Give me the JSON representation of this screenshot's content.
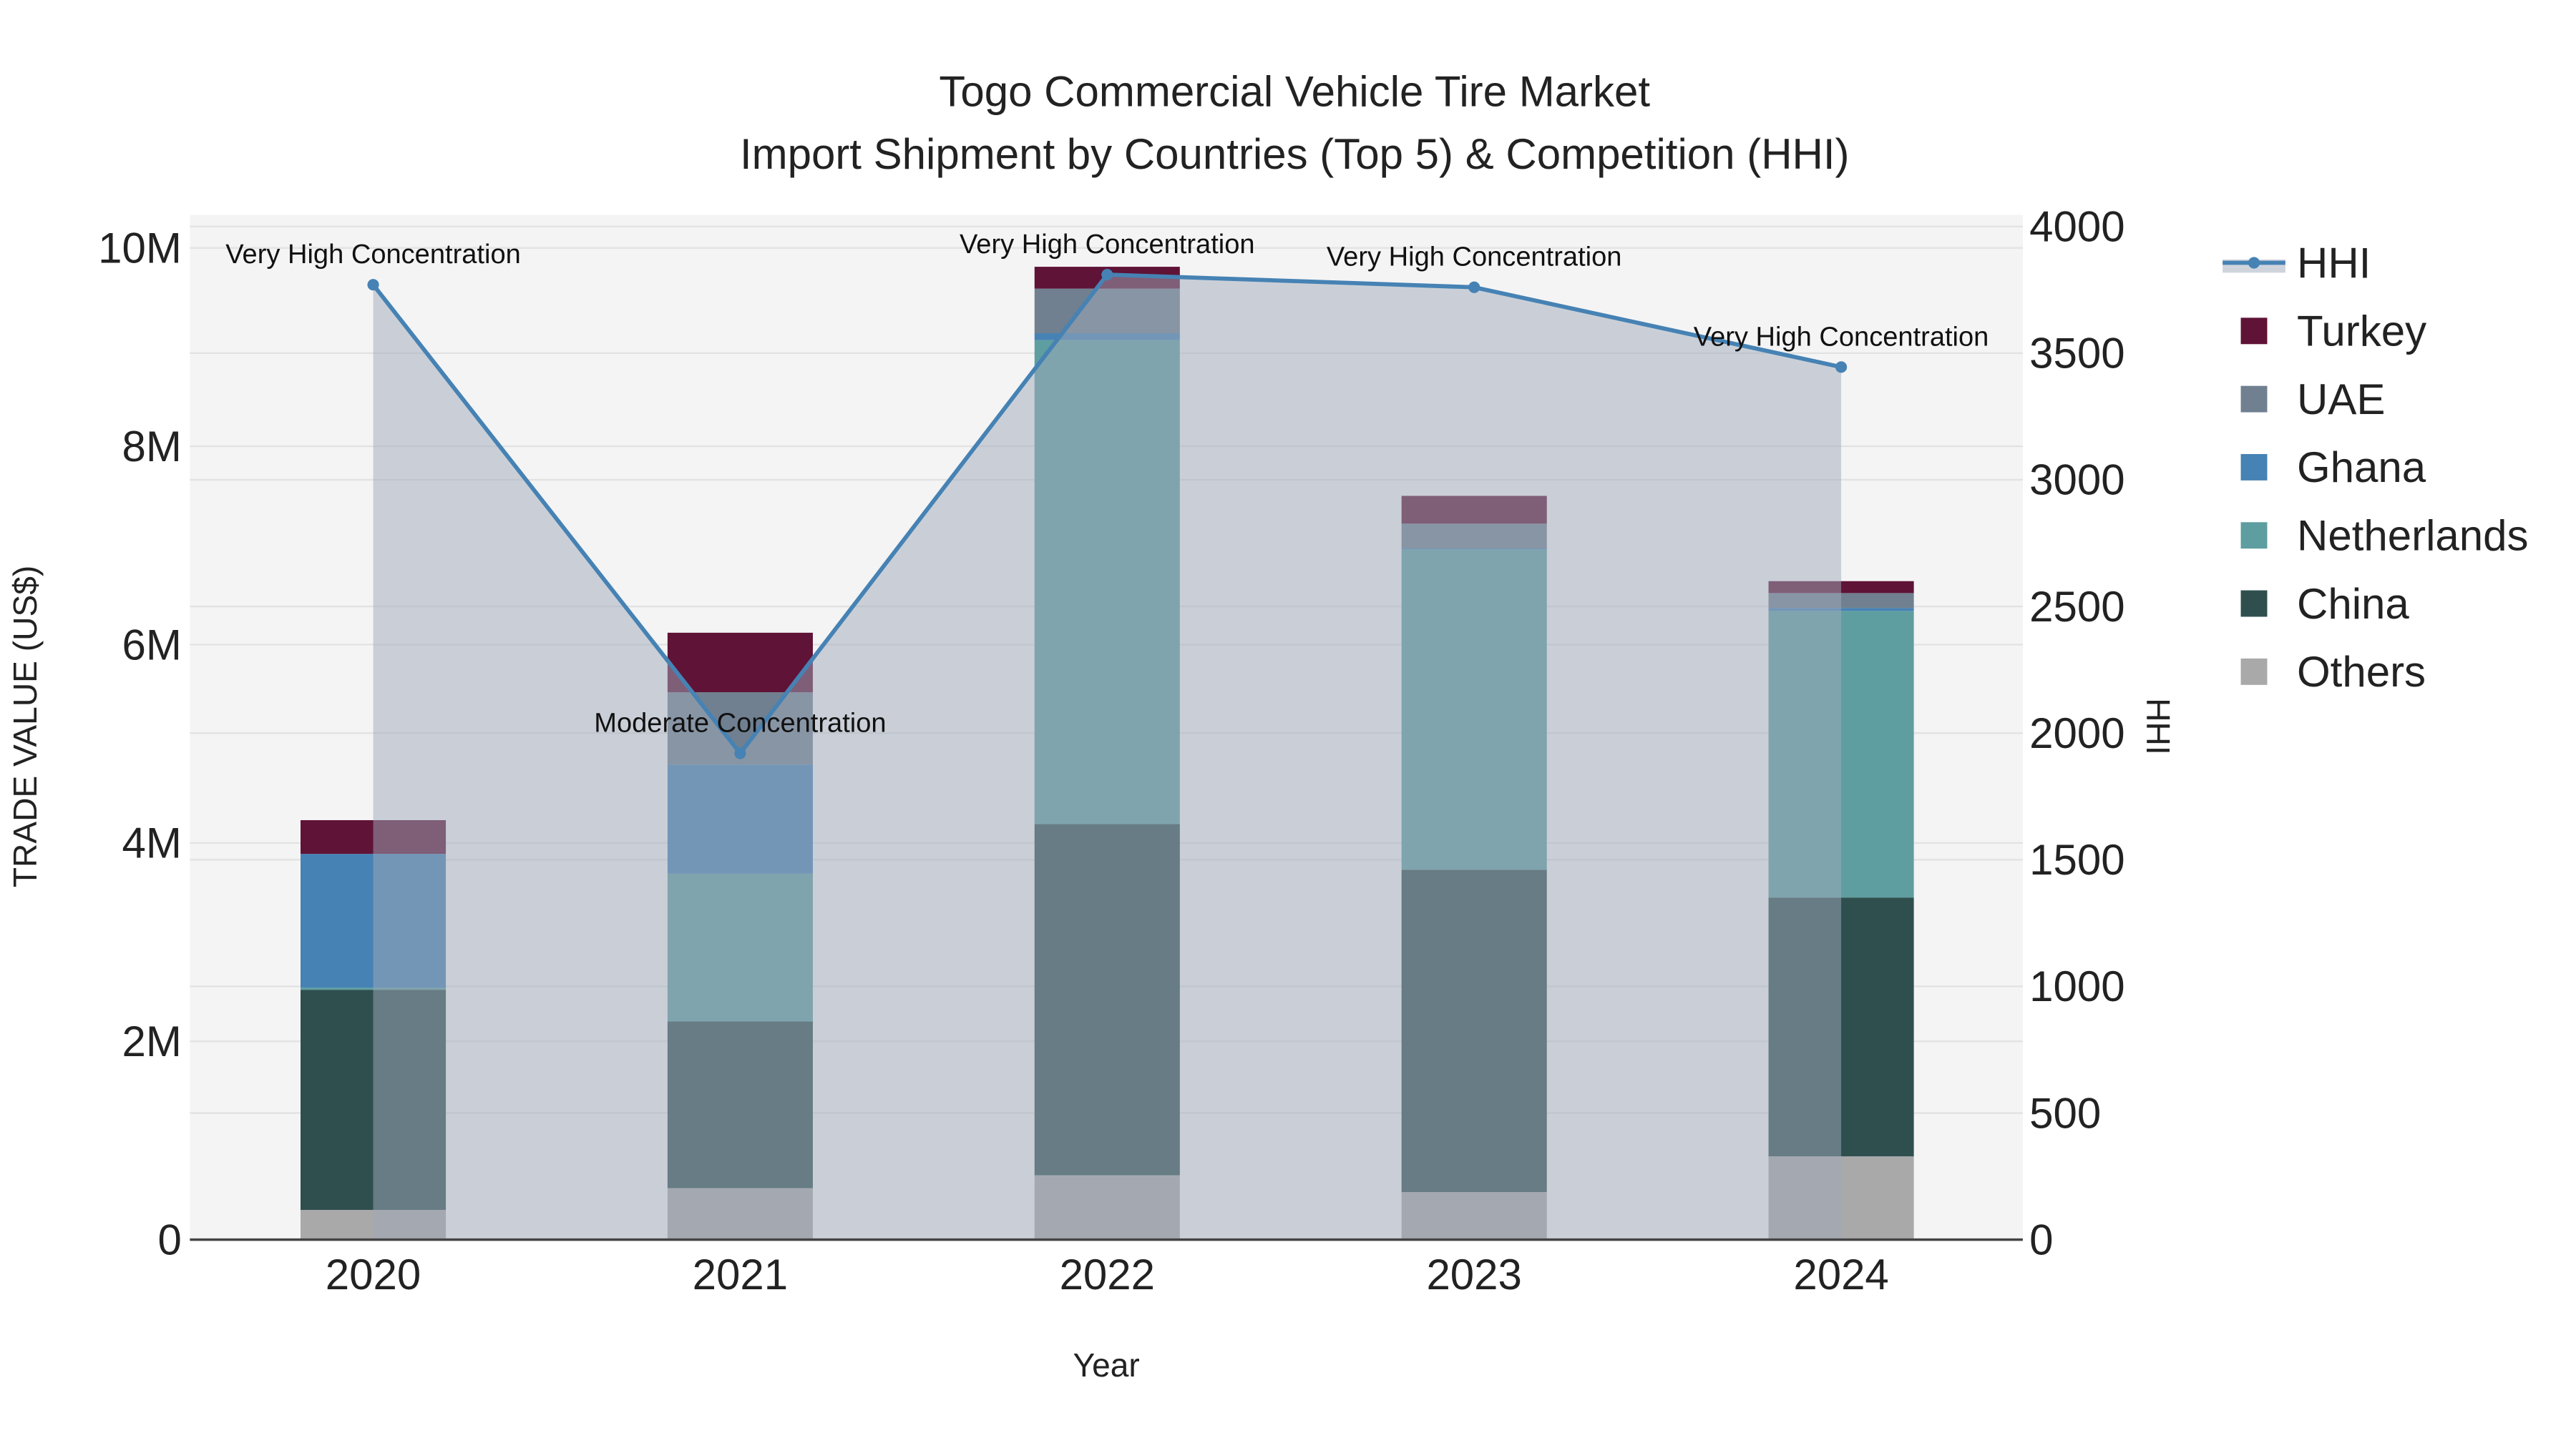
{
  "chart_data": {
    "type": "bar",
    "title_line1": "Togo Commercial Vehicle Tire Market",
    "title_line2": "Import Shipment by Countries (Top 5) & Competition (HHI)",
    "xlabel": "Year",
    "ylabel": "TRADE VALUE (US$)",
    "y2label": "HHI",
    "categories": [
      "2020",
      "2021",
      "2022",
      "2023",
      "2024"
    ],
    "ylim": [
      0,
      10200000
    ],
    "y_ticks": [
      0,
      2000000,
      4000000,
      6000000,
      8000000,
      10000000
    ],
    "y_tick_labels": [
      "0",
      "2M",
      "4M",
      "6M",
      "8M",
      "10M"
    ],
    "y2lim": [
      0,
      4080
    ],
    "y2_ticks": [
      0,
      500,
      1000,
      1500,
      2000,
      2500,
      3000,
      3500,
      4000
    ],
    "y2_tick_labels": [
      "0",
      "500",
      "1000",
      "1500",
      "2000",
      "2500",
      "3000",
      "3500",
      "4000"
    ],
    "stacked": true,
    "grid": true,
    "legend_position": "right",
    "series": [
      {
        "name": "Others",
        "color": "#a9a9a9",
        "values": [
          300000,
          520000,
          650000,
          480000,
          840000
        ]
      },
      {
        "name": "China",
        "color": "#2f4f4f",
        "values": [
          2220000,
          1680000,
          3540000,
          3250000,
          2610000
        ]
      },
      {
        "name": "Netherlands",
        "color": "#5f9ea0",
        "values": [
          20000,
          1490000,
          4880000,
          3230000,
          2890000
        ]
      },
      {
        "name": "Ghana",
        "color": "#4682b4",
        "values": [
          1350000,
          1100000,
          70000,
          10000,
          30000
        ]
      },
      {
        "name": "UAE",
        "color": "#708090",
        "values": [
          0,
          730000,
          450000,
          250000,
          150000
        ]
      },
      {
        "name": "Turkey",
        "color": "#5f1336",
        "values": [
          340000,
          600000,
          220000,
          280000,
          120000
        ]
      }
    ],
    "hhi": {
      "name": "HHI",
      "color": "#4682b4",
      "values": [
        3770,
        1920,
        3810,
        3760,
        3445
      ],
      "annotations": [
        "Very High Concentration",
        "Moderate Concentration",
        "Very High Concentration",
        "Very High Concentration",
        "Very High Concentration"
      ]
    },
    "legend_order": [
      "HHI",
      "Turkey",
      "UAE",
      "Ghana",
      "Netherlands",
      "China",
      "Others"
    ]
  }
}
